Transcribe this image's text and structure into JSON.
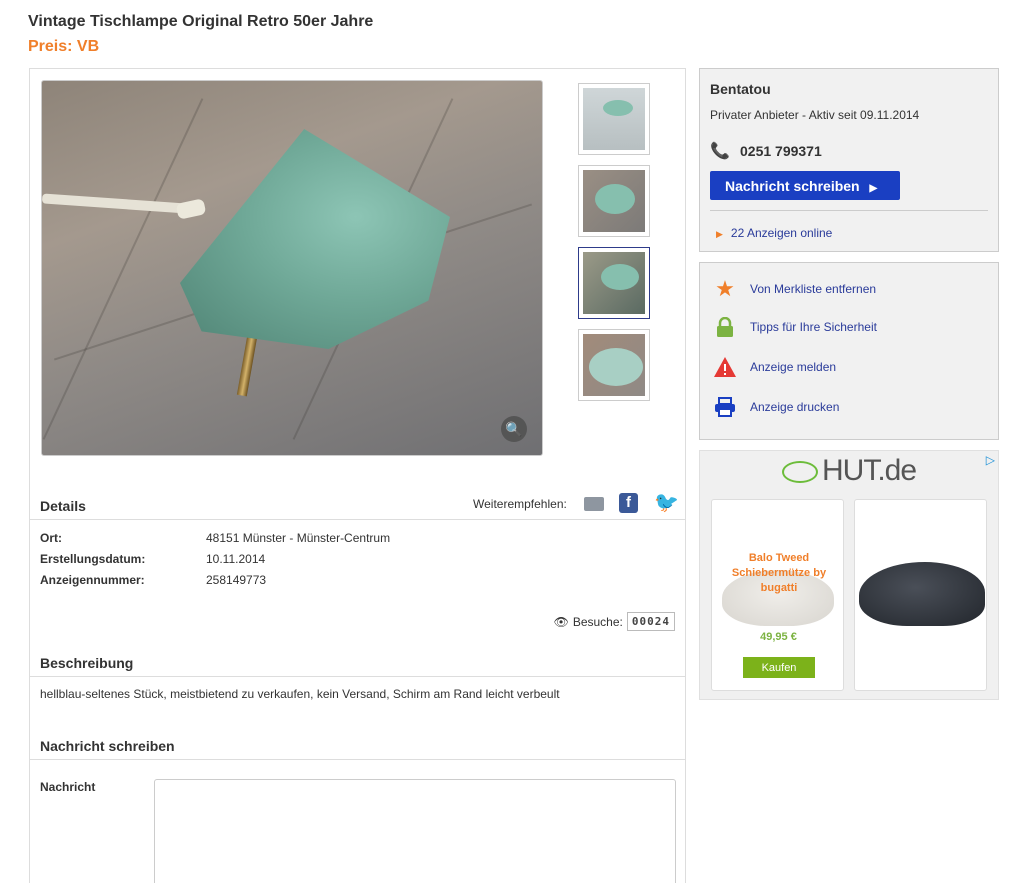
{
  "listing": {
    "title": "Vintage Tischlampe Original Retro 50er Jahre",
    "price": "Preis: VB"
  },
  "details": {
    "heading": "Details",
    "share_label": "Weiterempfehlen:",
    "rows": [
      {
        "label": "Ort:",
        "value": "48151 Münster - Münster-Centrum"
      },
      {
        "label": "Erstellungsdatum:",
        "value": "10.11.2014"
      },
      {
        "label": "Anzeigennummer:",
        "value": "258149773"
      }
    ],
    "visits_label": "Besuche:",
    "visits_count": "00024"
  },
  "description": {
    "heading": "Beschreibung",
    "text": "hellblau-seltenes Stück, meistbietend zu verkaufen, kein Versand, Schirm am Rand leicht verbeult"
  },
  "message": {
    "heading": "Nachricht schreiben",
    "label": "Nachricht"
  },
  "seller": {
    "name": "Bentatou",
    "sub": "Privater Anbieter - Aktiv seit 09.11.2014",
    "phone": "0251 799371",
    "button": "Nachricht schreiben",
    "ads_link": "22 Anzeigen online"
  },
  "actions": [
    {
      "label": "Von Merkliste entfernen",
      "icon": "star-icon",
      "color": "#f07f2a"
    },
    {
      "label": "Tipps für Ihre Sicherheit",
      "icon": "lock-icon",
      "color": "#7cb342"
    },
    {
      "label": "Anzeige melden",
      "icon": "warning-icon",
      "color": "#e53935"
    },
    {
      "label": "Anzeige drucken",
      "icon": "printer-icon",
      "color": "#1a3fc2"
    }
  ],
  "ad": {
    "brand": "HUT.de",
    "product_title": "Balo Tweed Schiebermütze by bugatti",
    "product_price": "49,95 €",
    "buy_label": "Kaufen"
  },
  "colors": {
    "accent_orange": "#f07f2a",
    "link_blue": "#2a3b9a",
    "button_blue": "#1a3fc2"
  }
}
